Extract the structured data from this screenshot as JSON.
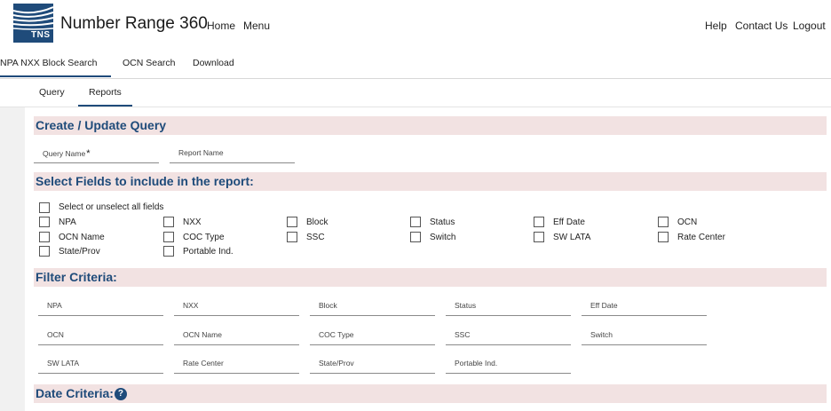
{
  "brand": {
    "logo_text": "TNS",
    "app_title": "Number Range 360",
    "accent": "#1f4b7a",
    "section_bg": "#f2e2e2"
  },
  "topnav": {
    "home": "Home",
    "menu": "Menu",
    "help": "Help",
    "contact": "Contact Us",
    "logout": "Logout"
  },
  "tabs": [
    "NPA NXX Block Search",
    "OCN Search",
    "Download"
  ],
  "subtabs": [
    "Query",
    "Reports"
  ],
  "sections": {
    "create": "Create / Update Query",
    "select": "Select Fields to include in the report:",
    "filter": "Filter Criteria:",
    "date": "Date Criteria:"
  },
  "query_fields": {
    "query_name": "Query Name",
    "required_mark": "*",
    "report_name": "Report Name"
  },
  "select_all": "Select or unselect all fields",
  "report_fields": [
    "NPA",
    "NXX",
    "Block",
    "Status",
    "Eff Date",
    "OCN",
    "OCN Name",
    "COC Type",
    "SSC",
    "Switch",
    "SW LATA",
    "Rate Center",
    "State/Prov",
    "Portable Ind."
  ],
  "filter_fields": [
    "NPA",
    "NXX",
    "Block",
    "Status",
    "Eff Date",
    "OCN",
    "OCN Name",
    "COC Type",
    "SSC",
    "Switch",
    "SW LATA",
    "Rate Center",
    "State/Prov",
    "Portable Ind."
  ],
  "help_icon": "question-icon"
}
